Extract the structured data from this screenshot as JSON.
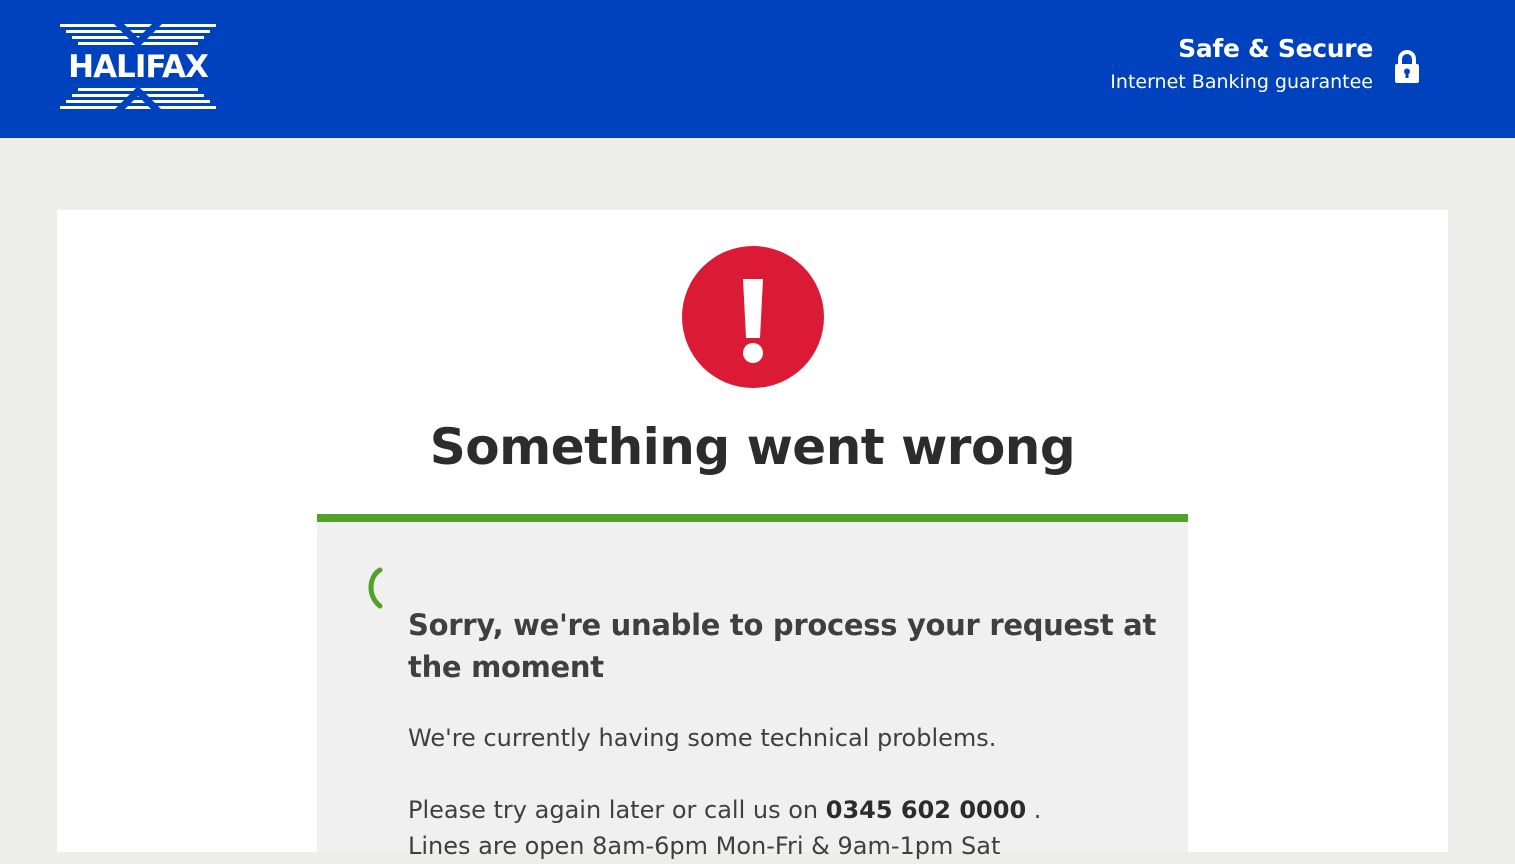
{
  "header": {
    "brand_name": "HALIFAX",
    "secure_title": "Safe & Secure",
    "secure_subtitle": "Internet Banking guarantee",
    "lock_icon": "lock-icon"
  },
  "error": {
    "icon": "exclamation-icon",
    "title": "Something went wrong"
  },
  "panel": {
    "icon": "phone-icon",
    "heading": "Sorry, we're unable to process your request at the moment",
    "line1": "We're currently having some technical problems.",
    "line2_prefix": "Please try again later or call us on",
    "phone_number": "0345 602 0000",
    "line2_suffix": ".",
    "line3": "Lines are open 8am-6pm Mon-Fri & 9am-1pm Sat"
  },
  "colors": {
    "header_bg": "#0042bd",
    "page_bg": "#ededeb",
    "alert_red": "#db1a35",
    "accent_green": "#51a226"
  }
}
